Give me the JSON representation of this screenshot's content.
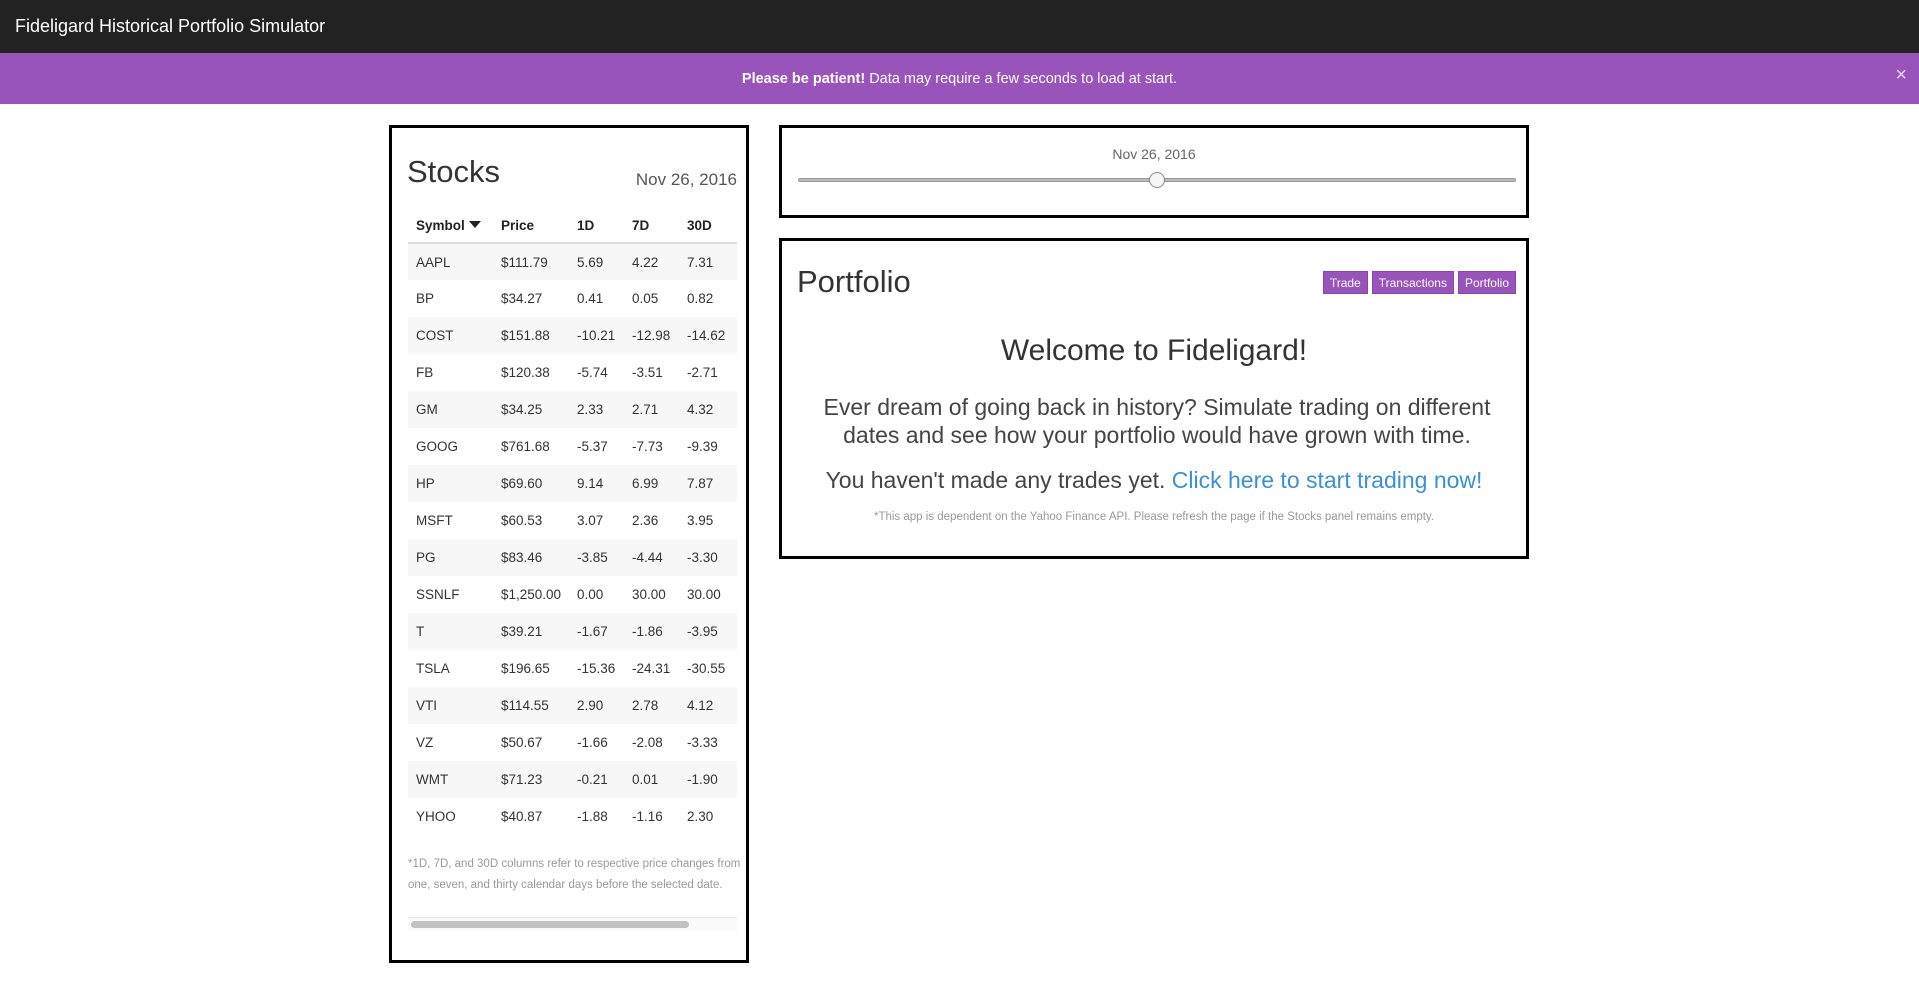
{
  "navbar": {
    "title": "Fideligard Historical Portfolio Simulator"
  },
  "alert": {
    "bold": "Please be patient!",
    "text": "Data may require a few seconds to load at start.",
    "close": "×"
  },
  "stocks": {
    "title": "Stocks",
    "date": "Nov 26, 2016",
    "columns": [
      "Symbol",
      "Price",
      "1D",
      "7D",
      "30D"
    ],
    "sort_column": "Symbol",
    "sort_direction": "descending",
    "rows": [
      [
        "AAPL",
        "$111.79",
        "5.69",
        "4.22",
        "7.31"
      ],
      [
        "BP",
        "$34.27",
        "0.41",
        "0.05",
        "0.82"
      ],
      [
        "COST",
        "$151.88",
        "-10.21",
        "-12.98",
        "-14.62"
      ],
      [
        "FB",
        "$120.38",
        "-5.74",
        "-3.51",
        "-2.71"
      ],
      [
        "GM",
        "$34.25",
        "2.33",
        "2.71",
        "4.32"
      ],
      [
        "GOOG",
        "$761.68",
        "-5.37",
        "-7.73",
        "-9.39"
      ],
      [
        "HP",
        "$69.60",
        "9.14",
        "6.99",
        "7.87"
      ],
      [
        "MSFT",
        "$60.53",
        "3.07",
        "2.36",
        "3.95"
      ],
      [
        "PG",
        "$83.46",
        "-3.85",
        "-4.44",
        "-3.30"
      ],
      [
        "SSNLF",
        "$1,250.00",
        "0.00",
        "30.00",
        "30.00"
      ],
      [
        "T",
        "$39.21",
        "-1.67",
        "-1.86",
        "-3.95"
      ],
      [
        "TSLA",
        "$196.65",
        "-15.36",
        "-24.31",
        "-30.55"
      ],
      [
        "VTI",
        "$114.55",
        "2.90",
        "2.78",
        "4.12"
      ],
      [
        "VZ",
        "$50.67",
        "-1.66",
        "-2.08",
        "-3.33"
      ],
      [
        "WMT",
        "$71.23",
        "-0.21",
        "0.01",
        "-1.90"
      ],
      [
        "YHOO",
        "$40.87",
        "-1.88",
        "-1.16",
        "2.30"
      ]
    ],
    "footnote": "*1D, 7D, and 30D columns refer to respective price changes from one, seven, and thirty calendar days before the selected date."
  },
  "date_slider": {
    "label": "Nov 26, 2016",
    "position_fraction": 0.5
  },
  "portfolio": {
    "title": "Portfolio",
    "buttons": [
      "Trade",
      "Transactions",
      "Portfolio"
    ],
    "welcome": "Welcome to Fideligard!",
    "intro": "Ever dream of going back in history? Simulate trading on different dates and see how your portfolio would have grown with time.",
    "no_trades_text": "You haven't made any trades yet.",
    "start_link": "Click here to start trading now!",
    "disclaimer": "*This app is dependent on the Yahoo Finance API. Please refresh the page if the Stocks panel remains empty."
  },
  "colors": {
    "navbar": "#222222",
    "accent": "#9854bb",
    "link": "#3b8fd6"
  }
}
